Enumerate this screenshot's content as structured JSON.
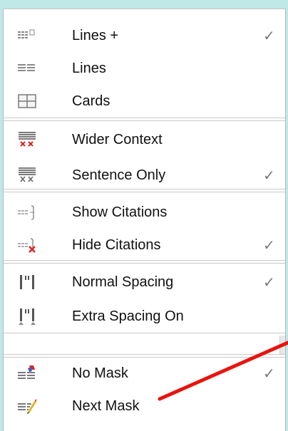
{
  "menu": {
    "items": [
      {
        "label": "Lines +",
        "checked": true,
        "icon": "lines-plus-icon"
      },
      {
        "label": "Lines",
        "checked": false,
        "icon": "lines-icon"
      },
      {
        "label": "Cards",
        "checked": false,
        "icon": "cards-icon"
      },
      {
        "label": "Wider Context",
        "checked": false,
        "icon": "wider-context-icon"
      },
      {
        "label": "Sentence Only",
        "checked": true,
        "icon": "sentence-only-icon"
      },
      {
        "label": "Show Citations",
        "checked": false,
        "icon": "show-citations-icon"
      },
      {
        "label": "Hide Citations",
        "checked": true,
        "icon": "hide-citations-icon"
      },
      {
        "label": "Normal Spacing",
        "checked": true,
        "icon": "normal-spacing-icon"
      },
      {
        "label": "Extra Spacing On",
        "checked": false,
        "icon": "extra-spacing-icon"
      },
      {
        "label": "No Mask",
        "checked": true,
        "icon": "no-mask-icon"
      },
      {
        "label": "Next Mask",
        "checked": false,
        "icon": "next-mask-icon"
      }
    ],
    "check_glyph": "✓"
  },
  "colors": {
    "background": "#bfe8e6",
    "annotation": "#e8140f",
    "check": "#7a7a7a"
  }
}
